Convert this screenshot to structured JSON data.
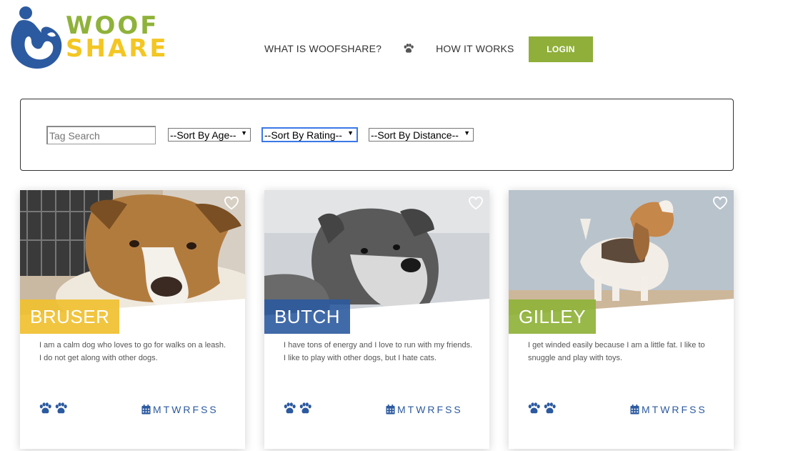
{
  "brand": {
    "line1": "WOOF",
    "line2": "SHARE",
    "colors": {
      "blue": "#2c5aa0",
      "green": "#8fb23a",
      "yellow": "#f3c623"
    }
  },
  "nav": {
    "link1": "WHAT IS WOOFSHARE?",
    "link2": "HOW IT WORKS",
    "login": "LOGIN",
    "separator_icon": "paw-icon"
  },
  "filters": {
    "tag_placeholder": "Tag Search",
    "age": "--Sort By Age--",
    "rating": "--Sort By Rating--",
    "distance": "--Sort By Distance--"
  },
  "dogs": [
    {
      "name": "BRUSER",
      "description": "I am a calm dog who loves to go for walks on a leash. I do not get along with other dogs.",
      "tag_color": "#f0c030",
      "paws": 2,
      "days": "MTWRFSS"
    },
    {
      "name": "BUTCH",
      "description": "I have tons of energy and I love to run with my friends. I like to play with other dogs, but I hate cats.",
      "tag_color": "#2c5aa0",
      "paws": 2,
      "days": "MTWRFSS"
    },
    {
      "name": "GILLEY",
      "description": "I get winded easily because I am a little fat. I like to snuggle and play with toys.",
      "tag_color": "#8fb23a",
      "paws": 2,
      "days": "MTWRFSS"
    }
  ]
}
